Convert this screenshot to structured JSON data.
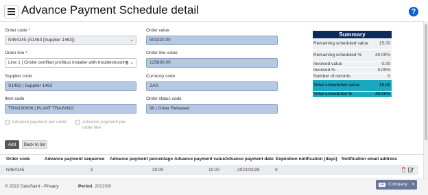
{
  "header": {
    "title": "Advance Payment Schedule detail",
    "help_label": "?"
  },
  "form": {
    "order_code": {
      "label": "Order code",
      "required": "*",
      "value": "N464145 (S1463 [Supplier 1463])"
    },
    "order_line": {
      "label": "Order line",
      "required": "*",
      "value": "Line 1 | Onsite certified profibus installer with troubleshooting",
      "clear": "×"
    },
    "supplier_code": {
      "label": "Supplier code",
      "value": "S1463 | Supplier 1463"
    },
    "item_code": {
      "label": "Item code",
      "value": "TRAI190006 | PLANT TRAINING"
    },
    "order_value": {
      "label": "Order value",
      "value": "503320.00"
    },
    "order_line_value": {
      "label": "Order line value",
      "value": "125830.00"
    },
    "currency_code": {
      "label": "Currency code",
      "value": "ZAR"
    },
    "order_status_code": {
      "label": "Order status code",
      "value": "90 | Order Released"
    },
    "chk_advance_per_order": {
      "label": "Advance payment per order",
      "checked": false
    },
    "chk_advance_per_order_line": {
      "label": "Advance payment per order line",
      "checked": true
    }
  },
  "summary": {
    "title": "Summary",
    "rows": [
      {
        "label": "Remaining scheduled value",
        "value": "15.00"
      },
      {
        "label": "Remaining scheduled %",
        "value": "40.00%"
      },
      {
        "label": "Invoiced value",
        "value": "0.00"
      },
      {
        "label": "Invoiced %",
        "value": "0.00%"
      },
      {
        "label": "Number of records",
        "value": "0"
      },
      {
        "label": "Total scheduled value",
        "value": "15.00"
      },
      {
        "label": "Total scheduled %",
        "value": "40.00%"
      }
    ]
  },
  "buttons": {
    "add": "Add",
    "back": "Back to list"
  },
  "grid": {
    "headers": {
      "order_code": "Order code",
      "sequence": "Advance payment sequence",
      "percentage": "Advance payment percentage",
      "value": "Advance payment value",
      "date": "Advance payment date",
      "expiration": "Expiration notification (days)",
      "email": "Notification email address"
    },
    "rows": [
      {
        "order_code": "N464145",
        "sequence": "1",
        "percentage": "20.00",
        "value": "10.00",
        "date": "2022/02/28",
        "expiration": "0",
        "email": ""
      }
    ]
  },
  "footer": {
    "copyright": "© 2022 DataSaint -",
    "privacy": "Privacy",
    "period_label": "Period",
    "period_value": "2022/08",
    "company_tag": "DB",
    "company_label": "Company"
  },
  "colors": {
    "field_fill": "#b7c9e2",
    "summary_header": "#0d2a5c",
    "summary_highlight": "#18a9c0",
    "help_icon": "#0b5fd6"
  }
}
